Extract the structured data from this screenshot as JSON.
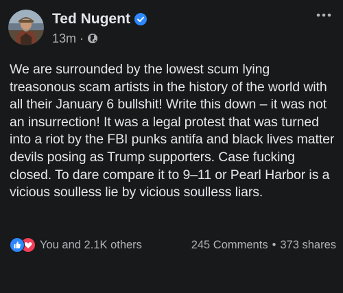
{
  "post": {
    "author": {
      "name": "Ted Nugent",
      "verified": true,
      "avatar_icon": "profile-photo"
    },
    "timestamp": "13m",
    "separator": "·",
    "audience_icon": "globe-icon",
    "text": "We are surrounded by the lowest scum lying treasonous scam artists in the history of the world with all their January 6 bullshit! Write this down – it was not an insurrection! It was a legal protest that was turned into a riot by the FBI punks antifa and black lives matter devils posing as Trump supporters. Case fucking closed. To dare compare it to 9–11 or Pearl Harbor is a vicious soulless lie by vicious soulless liars.",
    "reactions": {
      "icons": [
        "like-icon",
        "love-icon"
      ],
      "summary": "You and 2.1K others"
    },
    "comments": "245 Comments",
    "dot": "•",
    "shares": "373 shares"
  },
  "colors": {
    "background": "#18191a",
    "primary_text": "#e4e6eb",
    "secondary_text": "#b0b3b8",
    "verified_blue": "#2d88ff",
    "like_blue": "#2d88ff",
    "love_red": "#f33e58"
  }
}
